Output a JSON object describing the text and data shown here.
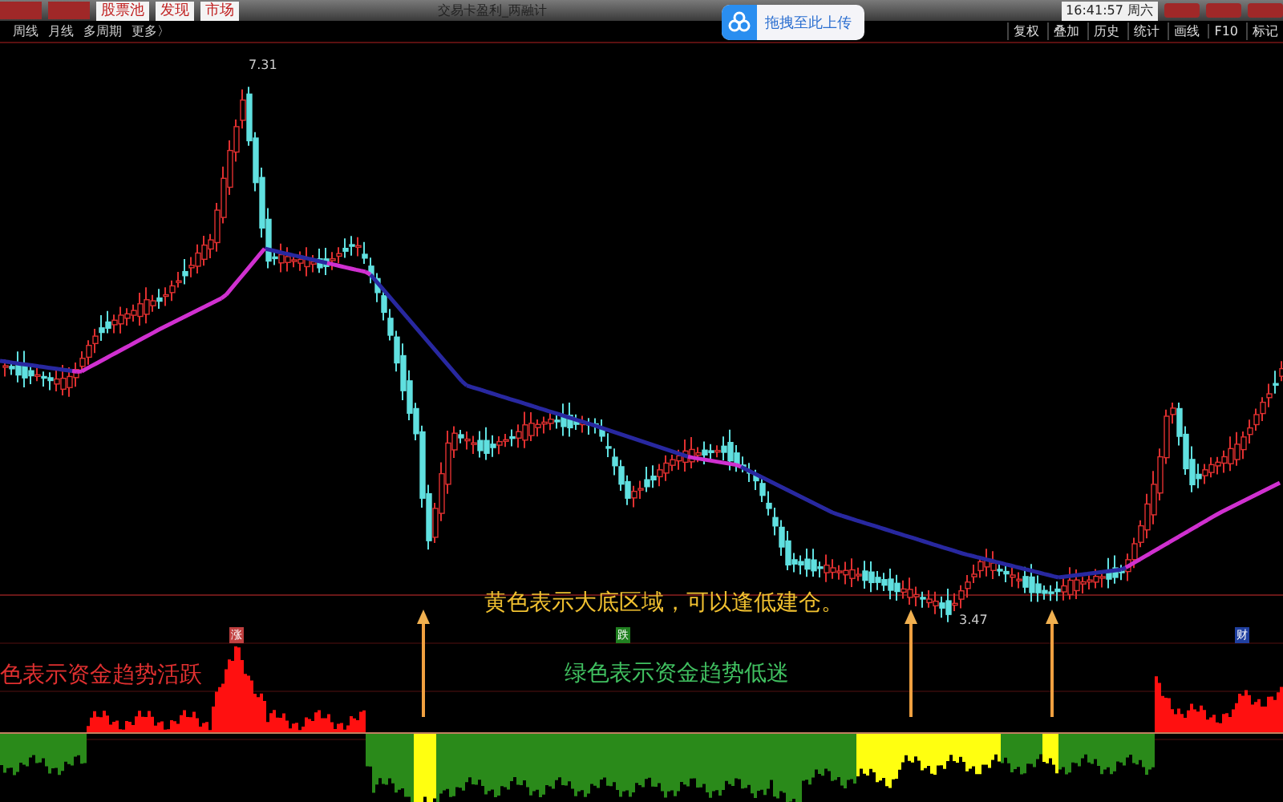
{
  "top_tabs": [
    {
      "label": "股票池"
    },
    {
      "label": "发现"
    },
    {
      "label": "市场"
    }
  ],
  "window": {
    "title": "交易卡盈利_两融计"
  },
  "upload_hint": {
    "label": "拖拽至此上传"
  },
  "clock": {
    "time": "16:41:57 周六"
  },
  "period_tabs": [
    {
      "label": "周线",
      "selected": false
    },
    {
      "label": "月线",
      "selected": false
    },
    {
      "label": "多周期",
      "selected": false
    },
    {
      "label": "更多〉",
      "selected": false
    }
  ],
  "tools": [
    "复权",
    "叠加",
    "历史",
    "统计",
    "画线",
    "F10",
    "标记"
  ],
  "price_chart": {
    "high_label": "7.31",
    "low_label": "3.47"
  },
  "event_marks": [
    {
      "label": "涨",
      "kind": "up"
    },
    {
      "label": "跌",
      "kind": "down"
    },
    {
      "label": "财",
      "kind": "finance"
    }
  ],
  "annotations": [
    {
      "text": "黄色表示大底区域，可以逢低建仓。",
      "color": "#f0c030"
    },
    {
      "text": "色表示资金趋势活跃",
      "color": "#e03030"
    },
    {
      "text": "绿色表示资金趋势低迷",
      "color": "#40c060"
    }
  ]
}
